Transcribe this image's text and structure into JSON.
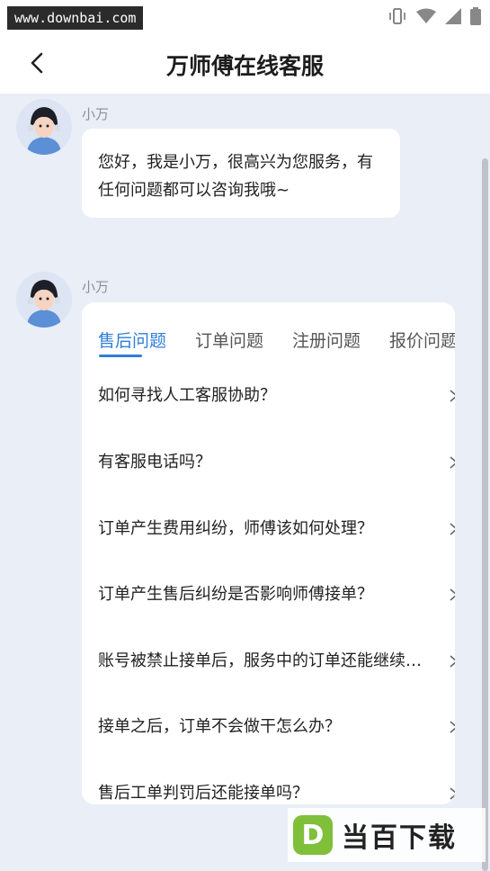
{
  "statusbar": {
    "watermark": "www.downbai.com"
  },
  "header": {
    "title": "万师傅在线客服"
  },
  "messages": [
    {
      "sender": "小万",
      "text": "您好，我是小万，很高兴为您服务，有任何问题都可以咨询我哦~"
    },
    {
      "sender": "小万"
    }
  ],
  "faq": {
    "tabs": [
      "售后问题",
      "订单问题",
      "注册问题",
      "报价问题"
    ],
    "active_tab": 0,
    "questions": [
      "如何寻找人工客服协助？",
      "有客服电话吗？",
      "订单产生费用纠纷，师傅该如何处理？",
      "订单产生售后纠纷是否影响师傅接单？",
      "账号被禁止接单后，服务中的订单还能继续服务吗？",
      "接单之后，订单不会做干怎么办？",
      "售后工单判罚后还能接单吗？"
    ]
  },
  "footer_watermark": {
    "logo_letter": "D",
    "text": "当百下载"
  },
  "colors": {
    "accent": "#2f7ed8",
    "background": "#e9eef7",
    "card": "#ffffff"
  }
}
